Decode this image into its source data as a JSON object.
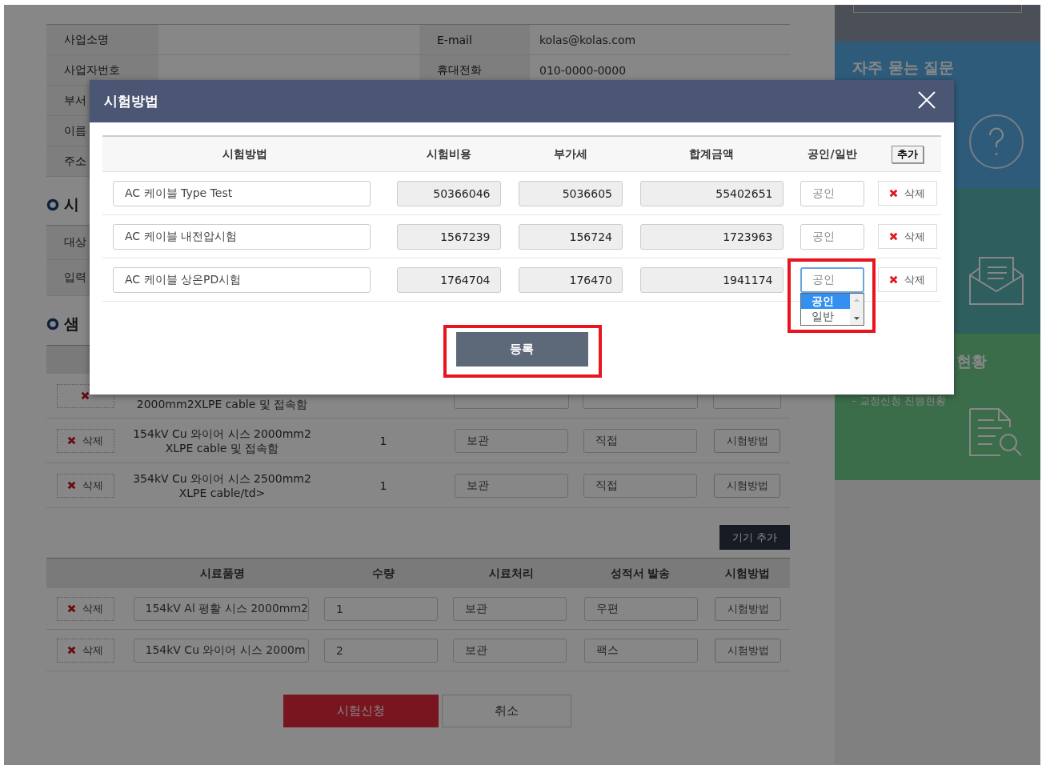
{
  "applicant_table": [
    {
      "label": "사업소명",
      "contact_label": "E-mail",
      "contact_value": "kolas@kolas.com"
    },
    {
      "label": "사업자번호",
      "contact_label": "휴대전화",
      "contact_value": "010-0000-0000"
    },
    {
      "label": "부서"
    },
    {
      "label": "이름"
    },
    {
      "label": "주소"
    }
  ],
  "test_section": {
    "heading": "시",
    "rows": [
      "대상",
      "입력"
    ]
  },
  "sample_section": {
    "heading": "샘",
    "rows": [
      {
        "kind": "covered",
        "name": "2000mm2XLPE cable 및 접속함"
      },
      {
        "kind": "full",
        "delete_label": "삭제",
        "name": "154kV Cu 와이어 시스 2000mm2\nXLPE cable 및 접속함",
        "quantity": "1",
        "handling": "보관",
        "delivery": "직접",
        "method_button": "시험방법"
      },
      {
        "kind": "full",
        "delete_label": "삭제",
        "name": "354kV Cu 와이어 시스 2500mm2\nXLPE cable/td>",
        "quantity": "1",
        "handling": "보관",
        "delivery": "직접",
        "method_button": "시험방법"
      }
    ]
  },
  "add_device_button": "기기 추가",
  "device_table": {
    "columns": [
      "시료품명",
      "수량",
      "시료처리",
      "성적서 발송",
      "시험방법"
    ],
    "rows": [
      {
        "delete_label": "삭제",
        "name": "154kV Al 평활 시스 2000mm2",
        "quantity": "1",
        "handling": "보관",
        "delivery": "우편",
        "method_button": "시험방법"
      },
      {
        "delete_label": "삭제",
        "name": "154kV Cu 와이어 시스 2000m",
        "quantity": "2",
        "handling": "보관",
        "delivery": "팩스",
        "method_button": "시험방법"
      }
    ]
  },
  "form_buttons": {
    "submit": "시험신청",
    "cancel": "취소"
  },
  "sidebar": [
    {
      "kind": "search"
    },
    {
      "kind": "faq",
      "title": "자주 묻는 질문"
    },
    {
      "kind": "mail"
    },
    {
      "kind": "status",
      "title": "현황",
      "subtitle": "- 교정신청 진행현황"
    }
  ],
  "modal": {
    "title": "시험방법",
    "columns": [
      "시험방법",
      "시험비용",
      "부가세",
      "합계금액",
      "공인/일반"
    ],
    "add_button": "추가",
    "rows": [
      {
        "method": "AC 케이블 Type Test",
        "cost": "50366046",
        "vat": "5036605",
        "total": "55402651",
        "certification": "공인",
        "delete_label": "삭제",
        "dropdown_open": false
      },
      {
        "method": "AC 케이블 내전압시험",
        "cost": "1567239",
        "vat": "156724",
        "total": "1723963",
        "certification": "공인",
        "delete_label": "삭제",
        "dropdown_open": false
      },
      {
        "method": "AC 케이블 상온PD시험",
        "cost": "1764704",
        "vat": "176470",
        "total": "1941174",
        "certification": "공인",
        "delete_label": "삭제",
        "dropdown_open": true
      }
    ],
    "dropdown_options": [
      {
        "label": "공인",
        "selected": true
      },
      {
        "label": "일반",
        "selected": false
      }
    ],
    "register_button": "등록",
    "register_highlighted": true
  }
}
